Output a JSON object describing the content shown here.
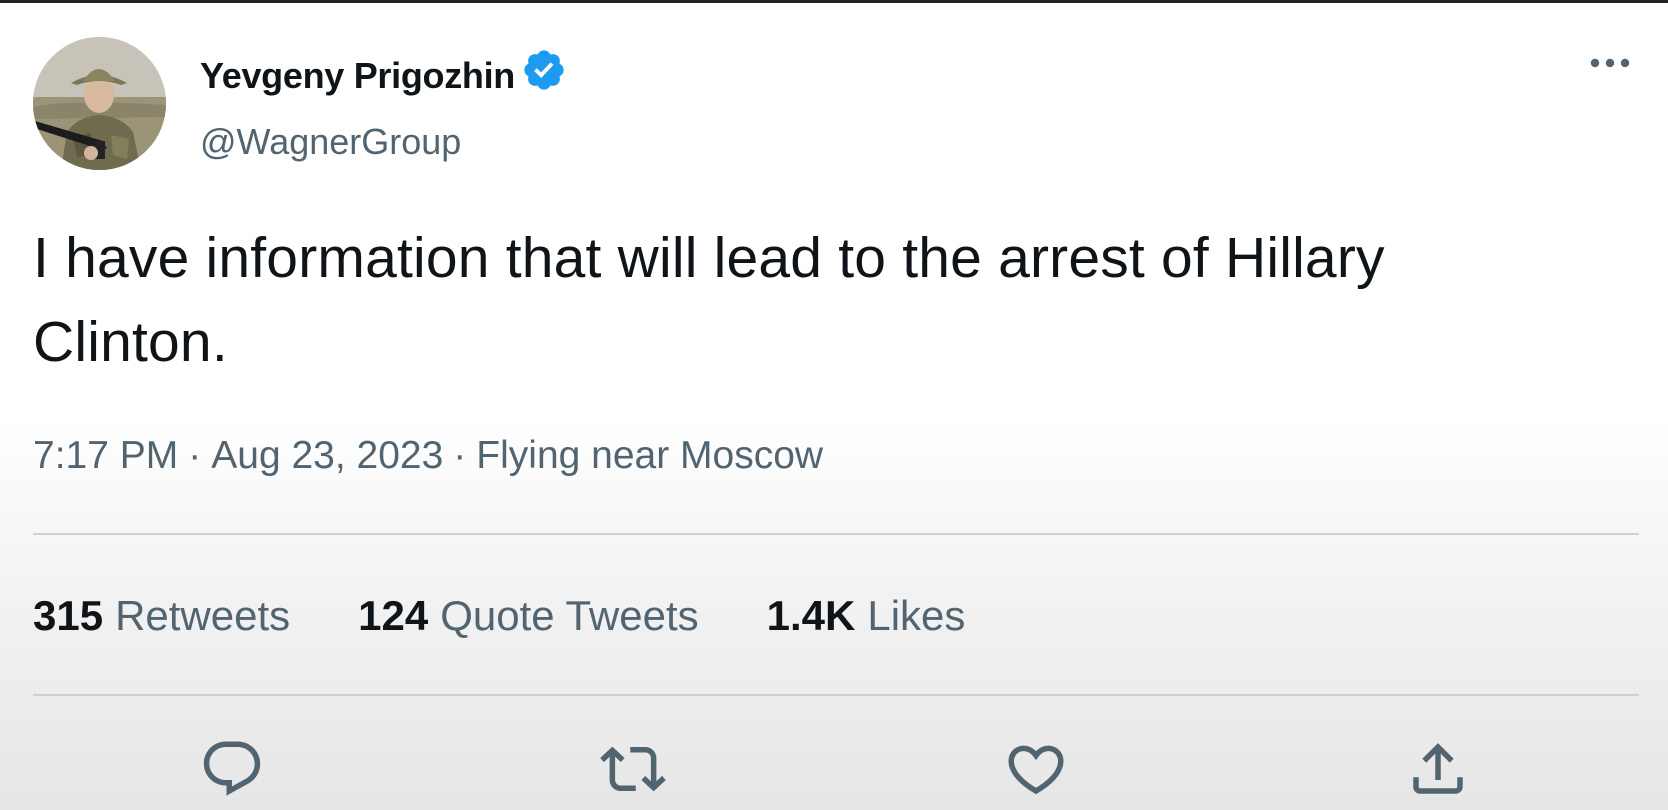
{
  "tweet": {
    "author": {
      "display_name": "Yevgeny Prigozhin",
      "handle": "@WagnerGroup",
      "verified": true,
      "verified_icon": "verified-badge-icon",
      "verified_color": "#1d9bf0"
    },
    "more_icon": "more-horizontal-icon",
    "text_line1": "I have information that will lead to the arrest of Hillary",
    "text_line2": "Clinton.",
    "meta": {
      "time": "7:17 PM",
      "separator": "·",
      "date": "Aug 23, 2023",
      "location": "Flying near Moscow"
    },
    "stats": {
      "retweets_count": "315",
      "retweets_label": "Retweets",
      "quotes_count": "124",
      "quotes_label": "Quote Tweets",
      "likes_count": "1.4K",
      "likes_label": "Likes"
    },
    "actions": [
      {
        "name": "reply",
        "icon": "reply-icon"
      },
      {
        "name": "retweet",
        "icon": "retweet-icon"
      },
      {
        "name": "like",
        "icon": "heart-icon"
      },
      {
        "name": "share",
        "icon": "share-icon"
      }
    ]
  },
  "colors": {
    "text_primary": "#0f1419",
    "text_secondary": "#536471",
    "accent": "#1d9bf0"
  }
}
